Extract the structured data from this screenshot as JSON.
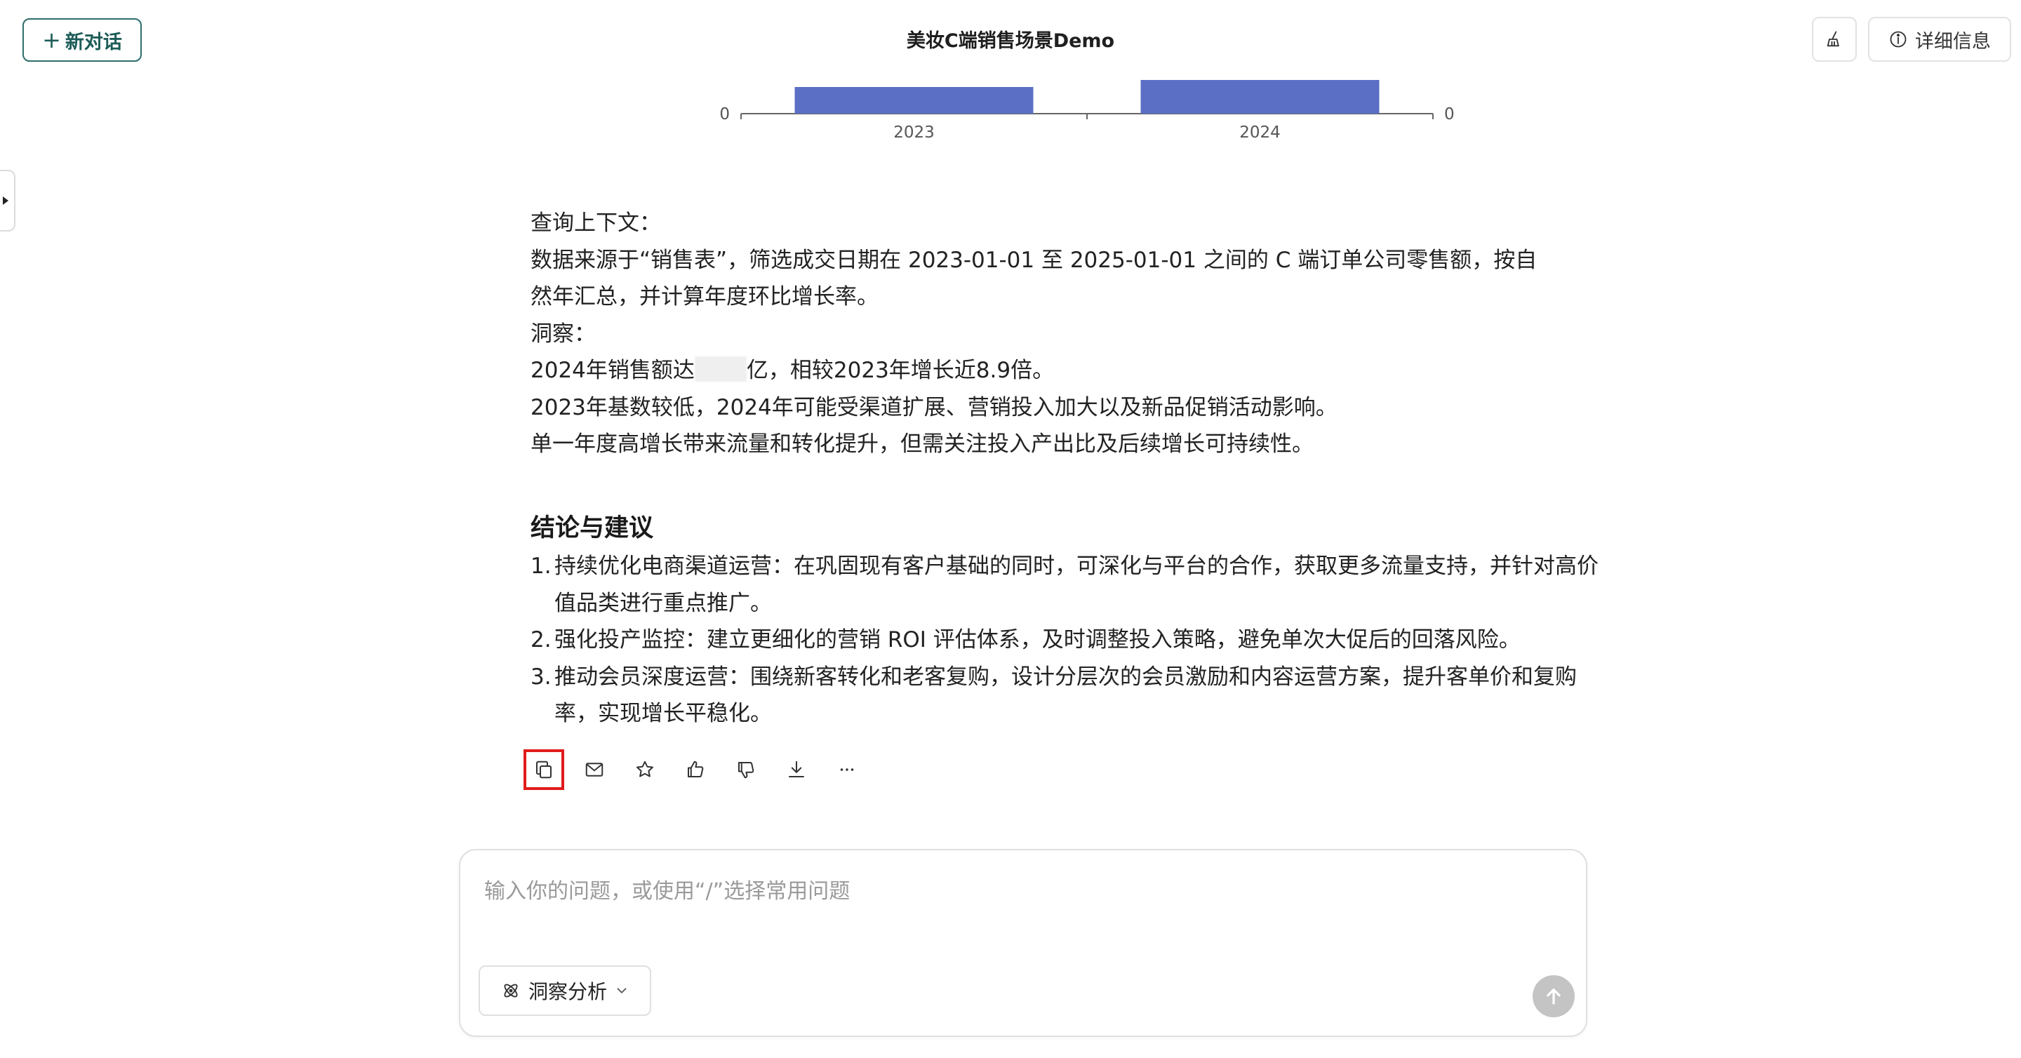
{
  "header": {
    "new_chat_label": "新对话",
    "title": "美妆C端销售场景Demo",
    "detail_label": "详细信息"
  },
  "chart_data": {
    "type": "bar",
    "categories": [
      "2023",
      "2024"
    ],
    "values": [
      0.38,
      0.48
    ],
    "left_axis_tick": "0",
    "right_axis_tick": "0",
    "bar_color": "#5b6fc4"
  },
  "message": {
    "lines": [
      "查询上下文：",
      "数据来源于“销售表”，筛选成交日期在 2023-01-01 至 2025-01-01 之间的 C 端订单公司零售额，按自",
      "然年汇总，并计算年度环比增长率。",
      "洞察："
    ],
    "insight_prefix": "2024年销售额达",
    "insight_suffix": "亿，相较2023年增长近8.9倍。",
    "lines_after": [
      "2023年基数较低，2024年可能受渠道扩展、营销投入加大以及新品促销活动影响。",
      "单一年度高增长带来流量和转化提升，但需关注投入产出比及后续增长可持续性。"
    ]
  },
  "conclusion": {
    "title": "结论与建议",
    "items": [
      {
        "num": "1.",
        "text": "持续优化电商渠道运营：在巩固现有客户基础的同时，可深化与平台的合作，获取更多流量支持，并针对高价值品类进行重点推广。"
      },
      {
        "num": "2.",
        "text": "强化投产监控：建立更细化的营销 ROI 评估体系，及时调整投入策略，避免单次大促后的回落风险。"
      },
      {
        "num": "3.",
        "text": "推动会员深度运营：围绕新客转化和老客复购，设计分层次的会员激励和内容运营方案，提升客单价和复购率，实现增长平稳化。"
      }
    ]
  },
  "actions": [
    "copy-icon",
    "mail-icon",
    "star-icon",
    "thumbs-up-icon",
    "thumbs-down-icon",
    "download-icon",
    "more-icon"
  ],
  "composer": {
    "placeholder": "输入你的问题，或使用“/”选择常用问题",
    "mode_label": "洞察分析"
  },
  "colors": {
    "accent": "#2c6e6a",
    "highlight": "#e11b1b",
    "send_disabled": "#c4c4c4"
  }
}
